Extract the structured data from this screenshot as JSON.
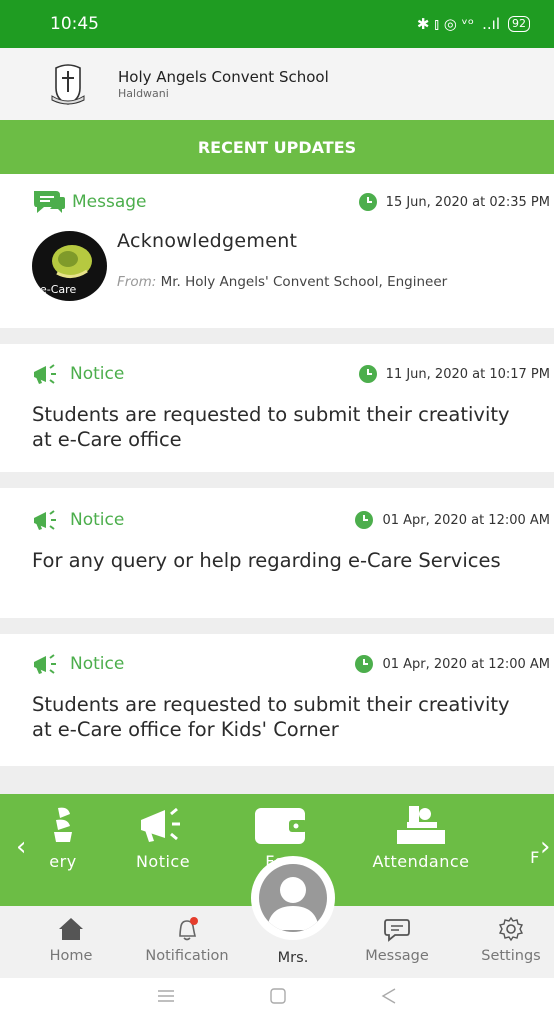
{
  "status": {
    "time": "10:45",
    "icons": "✱ ⫾ ◎ ᵛᵒ",
    "signal": "..ıl",
    "battery": "92"
  },
  "school": {
    "name": "Holy Angels Convent School",
    "city": "Haldwani"
  },
  "updates_title": "RECENT UPDATES",
  "colors": {
    "status_green": "#1f9c22",
    "accent_green": "#6cbd45",
    "label_green": "#4cae4c"
  },
  "feed": [
    {
      "type": "Message",
      "time": "15 Jun, 2020 at 02:35 PM",
      "title": "Acknowledgement",
      "from_label": "From:",
      "from": " Mr. Holy Angels' Convent School, Engineer",
      "logo_text": "e-Care"
    },
    {
      "type": "Notice",
      "time": "11 Jun, 2020 at 10:17 PM",
      "text": "Students are requested to submit their creativity at e-Care office"
    },
    {
      "type": "Notice",
      "time": "01 Apr, 2020 at 12:00 AM",
      "text": "For any query or help regarding e-Care Services"
    },
    {
      "type": "Notice",
      "time": "01 Apr, 2020 at 12:00 AM",
      "text": "Students are requested to submit their creativity at e-Care office for Kids' Corner"
    }
  ],
  "shortcuts": [
    {
      "label": "ery",
      "icon": "gallery-icon"
    },
    {
      "label": "Notice",
      "icon": "megaphone-icon"
    },
    {
      "label": "Fee",
      "icon": "wallet-icon"
    },
    {
      "label": "Attendance",
      "icon": "desk-icon"
    },
    {
      "label": "F",
      "icon": "partial-icon"
    }
  ],
  "nav": [
    {
      "label": "Home",
      "icon": "home-icon"
    },
    {
      "label": "Notification",
      "icon": "bell-icon"
    },
    {
      "label": "Mrs.",
      "icon": "avatar-icon"
    },
    {
      "label": "Message",
      "icon": "chat-icon"
    },
    {
      "label": "Settings",
      "icon": "gear-icon"
    }
  ]
}
